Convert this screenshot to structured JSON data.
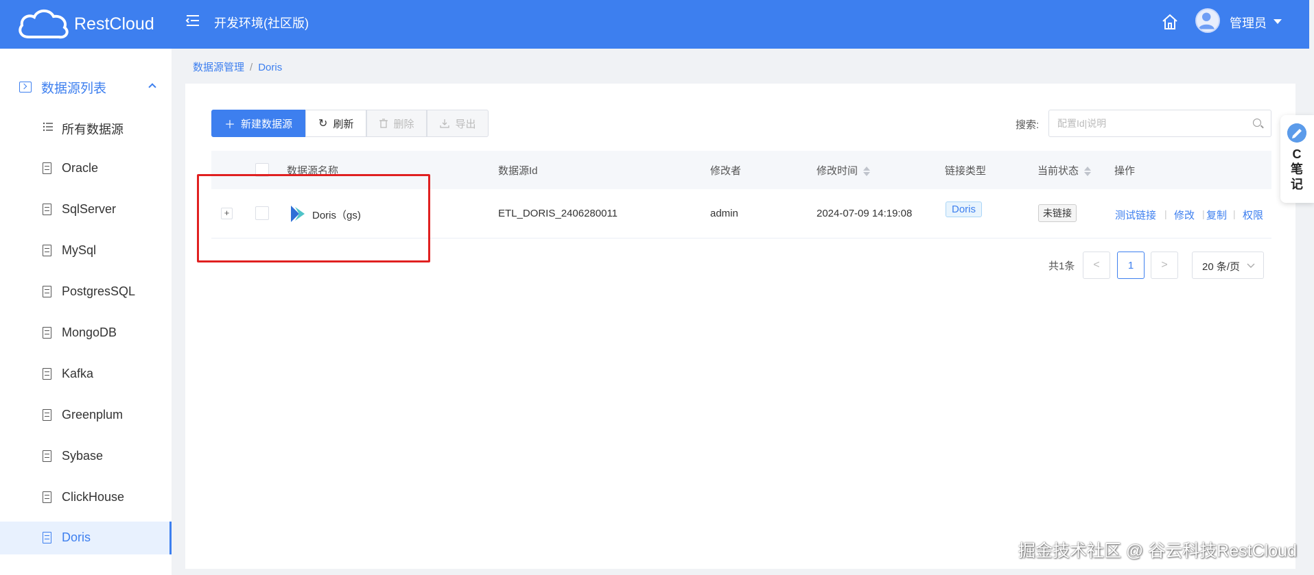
{
  "header": {
    "logo_text": "RestCloud",
    "env_title": "开发环境(社区版)",
    "user_name": "管理员"
  },
  "sidebar": {
    "group_label": "数据源列表",
    "items": [
      {
        "label": "所有数据源",
        "icon": "list-icon"
      },
      {
        "label": "Oracle",
        "icon": "database-icon"
      },
      {
        "label": "SqlServer",
        "icon": "database-icon"
      },
      {
        "label": "MySql",
        "icon": "database-icon"
      },
      {
        "label": "PostgresSQL",
        "icon": "database-icon"
      },
      {
        "label": "MongoDB",
        "icon": "database-icon"
      },
      {
        "label": "Kafka",
        "icon": "database-icon"
      },
      {
        "label": "Greenplum",
        "icon": "database-icon"
      },
      {
        "label": "Sybase",
        "icon": "database-icon"
      },
      {
        "label": "ClickHouse",
        "icon": "database-icon"
      },
      {
        "label": "Doris",
        "icon": "database-icon",
        "active": true
      }
    ]
  },
  "breadcrumb": {
    "root": "数据源管理",
    "sep": "/",
    "current": "Doris"
  },
  "toolbar": {
    "new_label": "新建数据源",
    "refresh_label": "刷新",
    "delete_label": "删除",
    "export_label": "导出",
    "search_label": "搜索:",
    "search_placeholder": "配置Id|说明"
  },
  "table": {
    "headers": {
      "name": "数据源名称",
      "id": "数据源Id",
      "modifier": "修改者",
      "modified_time": "修改时间",
      "link_type": "链接类型",
      "status": "当前状态",
      "actions": "操作"
    },
    "rows": [
      {
        "expand": "+",
        "name": "Doris（gs)",
        "id": "ETL_DORIS_2406280011",
        "modifier": "admin",
        "modified_time": "2024-07-09 14:19:08",
        "link_type": "Doris",
        "status": "未链接",
        "actions": {
          "test": "测试链接",
          "edit": "修改",
          "copy": "复制",
          "perm": "权限",
          "sep": "|"
        }
      }
    ]
  },
  "pagination": {
    "total": "共1条",
    "prev": "<",
    "current": "1",
    "next": ">",
    "page_size": "20 条/页"
  },
  "note_widget": {
    "text": "C笔记"
  },
  "watermark": "掘金技术社区 @ 谷云科技RestCloud",
  "colors": {
    "primary": "#3d7fef",
    "highlight": "#e02020"
  }
}
